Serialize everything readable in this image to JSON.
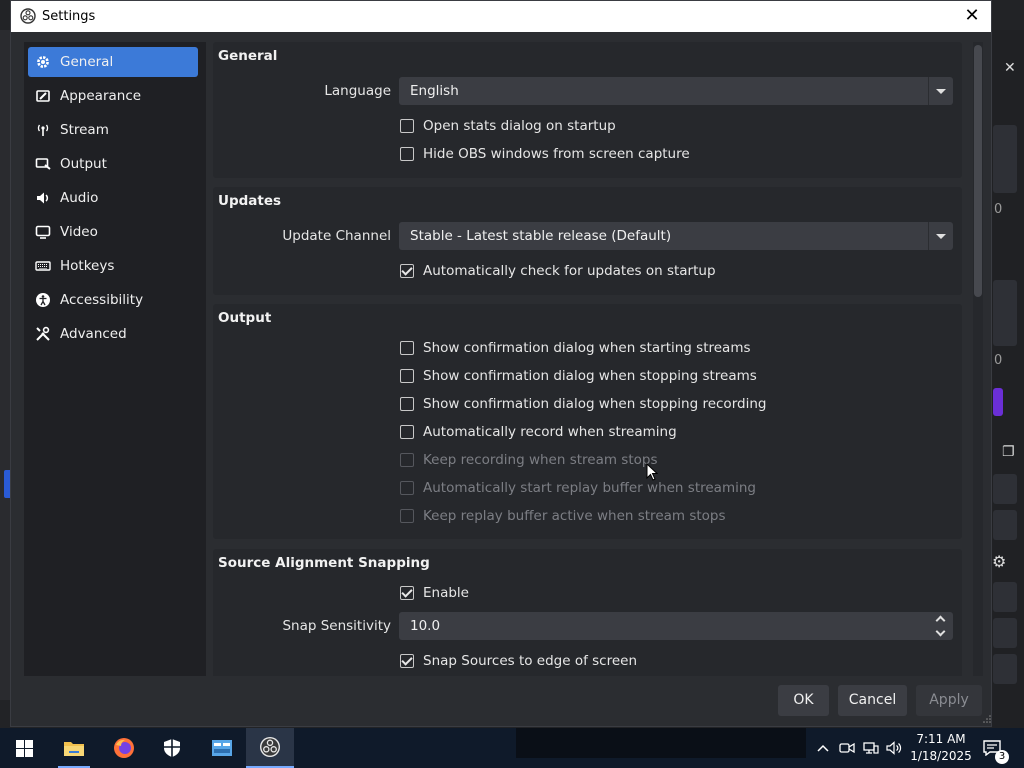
{
  "dialog": {
    "title": "Settings"
  },
  "sidebar": {
    "items": [
      {
        "label": "General",
        "icon": "gear-icon",
        "active": true
      },
      {
        "label": "Appearance",
        "icon": "appearance-icon",
        "active": false
      },
      {
        "label": "Stream",
        "icon": "stream-icon",
        "active": false
      },
      {
        "label": "Output",
        "icon": "output-icon",
        "active": false
      },
      {
        "label": "Audio",
        "icon": "speaker-icon",
        "active": false
      },
      {
        "label": "Video",
        "icon": "monitor-icon",
        "active": false
      },
      {
        "label": "Hotkeys",
        "icon": "keyboard-icon",
        "active": false
      },
      {
        "label": "Accessibility",
        "icon": "accessibility-icon",
        "active": false
      },
      {
        "label": "Advanced",
        "icon": "tools-icon",
        "active": false
      }
    ]
  },
  "general": {
    "title": "General",
    "language_label": "Language",
    "language_value": "English",
    "open_stats_label": "Open stats dialog on startup",
    "open_stats_checked": false,
    "hide_obs_label": "Hide OBS windows from screen capture",
    "hide_obs_checked": false
  },
  "updates": {
    "title": "Updates",
    "channel_label": "Update Channel",
    "channel_value": "Stable - Latest stable release (Default)",
    "auto_check_label": "Automatically check for updates on startup",
    "auto_check_checked": true
  },
  "output": {
    "title": "Output",
    "options": [
      {
        "label": "Show confirmation dialog when starting streams",
        "checked": false,
        "disabled": false
      },
      {
        "label": "Show confirmation dialog when stopping streams",
        "checked": false,
        "disabled": false
      },
      {
        "label": "Show confirmation dialog when stopping recording",
        "checked": false,
        "disabled": false
      },
      {
        "label": "Automatically record when streaming",
        "checked": false,
        "disabled": false
      },
      {
        "label": "Keep recording when stream stops",
        "checked": false,
        "disabled": true
      },
      {
        "label": "Automatically start replay buffer when streaming",
        "checked": false,
        "disabled": true
      },
      {
        "label": "Keep replay buffer active when stream stops",
        "checked": false,
        "disabled": true
      }
    ]
  },
  "snapping": {
    "title": "Source Alignment Snapping",
    "enable_label": "Enable",
    "enable_checked": true,
    "sensitivity_label": "Snap Sensitivity",
    "sensitivity_value": "10.0",
    "snap_edge_label": "Snap Sources to edge of screen",
    "snap_edge_checked": true
  },
  "buttons": {
    "ok": "OK",
    "cancel": "Cancel",
    "apply": "Apply"
  },
  "background": {
    "right_text_1": "0",
    "right_text_2": "0"
  },
  "taskbar": {
    "time": "7:11 AM",
    "date": "1/18/2025",
    "notification_count": "3",
    "apps": [
      "start-icon",
      "file-explorer-icon",
      "firefox-icon",
      "security-icon",
      "control-panel-icon",
      "obs-icon"
    ]
  },
  "colors": {
    "accent": "#3c7ad8",
    "dialog_bg": "#2b2d31",
    "group_bg": "#26282c",
    "control_bg": "#3b3d43"
  }
}
